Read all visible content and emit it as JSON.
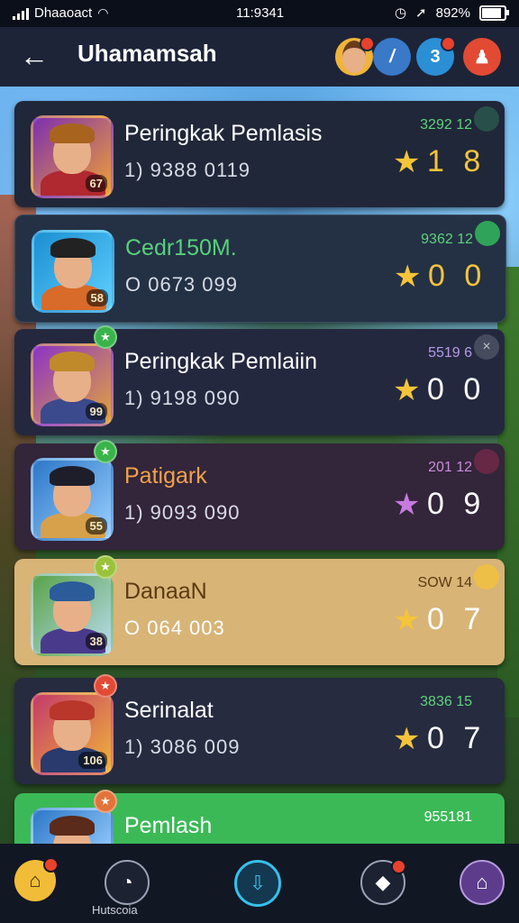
{
  "status_bar": {
    "carrier": "Dhaaoact",
    "time": "11:9341",
    "battery": "892%"
  },
  "header": {
    "back_icon": "arrow-left-icon",
    "title": "Uhamamsah",
    "buttons": [
      {
        "icon": "avatar-icon"
      },
      {
        "icon": "slash-icon",
        "glyph": "/"
      },
      {
        "icon": "trophy-icon",
        "glyph": "3"
      },
      {
        "icon": "profile-icon"
      }
    ]
  },
  "rows": [
    {
      "name": "Peringkak Pemlasis",
      "sub": "1) 9388 0119",
      "code": "3292 12",
      "code_color": "#5fd27a",
      "star": "★",
      "star_color": "#f4c43a",
      "score": "1 8",
      "score_color": "#f4c43a",
      "level": "67",
      "badge": ""
    },
    {
      "name": "Cedr150M.",
      "name_color": "#58d17a",
      "sub": "O 0673 099",
      "code": "9362 12",
      "code_color": "#5fd27a",
      "star": "★",
      "star_color": "#f4c43a",
      "score": "0 0",
      "score_color": "#f4c43a",
      "level": "58",
      "badge": ""
    },
    {
      "name": "Peringkak Pemlaiin",
      "sub": "1) 9198 090",
      "code": "5519 6",
      "code_color": "#b59be6",
      "star": "★",
      "star_color": "#f4c43a",
      "score": "0 0",
      "score_color": "#ffffff",
      "level": "99",
      "badge": "★"
    },
    {
      "name": "Patigark",
      "name_color": "#f0a24a",
      "sub": "1) 9093 090",
      "code": "201 12",
      "code_color": "#c98ddb",
      "star": "★",
      "star_color": "#c77adf",
      "score": "0 9",
      "score_color": "#ffffff",
      "level": "55",
      "badge": "★"
    },
    {
      "name": "DanaaN",
      "name_color": "#5a3b10",
      "sub": "O 064 003",
      "code": "SOW 14",
      "code_color": "#5a3b10",
      "star": "★",
      "star_color": "#f4c43a",
      "score": "0 7",
      "score_color": "#ffffff",
      "level": "38",
      "badge": "★"
    },
    {
      "name": "Serinalat",
      "sub": "1) 3086 009",
      "code": "3836 15",
      "code_color": "#5fd27a",
      "star": "★",
      "star_color": "#f4c43a",
      "score": "0 7",
      "score_color": "#ffffff",
      "level": "106",
      "badge": "★"
    },
    {
      "name": "Pemlash",
      "sub": "",
      "code": "955181",
      "code_color": "#ffffff",
      "star": "",
      "star_color": "#ffffff",
      "score": "",
      "score_color": "#ffffff",
      "level": "",
      "badge": "★"
    }
  ],
  "nav": {
    "items": [
      {
        "icon": "home-icon"
      },
      {
        "icon": "clock-icon",
        "label": "Hutscoia"
      },
      {
        "icon": "download-icon"
      },
      {
        "icon": "shield-icon"
      },
      {
        "icon": "castle-icon"
      }
    ]
  }
}
